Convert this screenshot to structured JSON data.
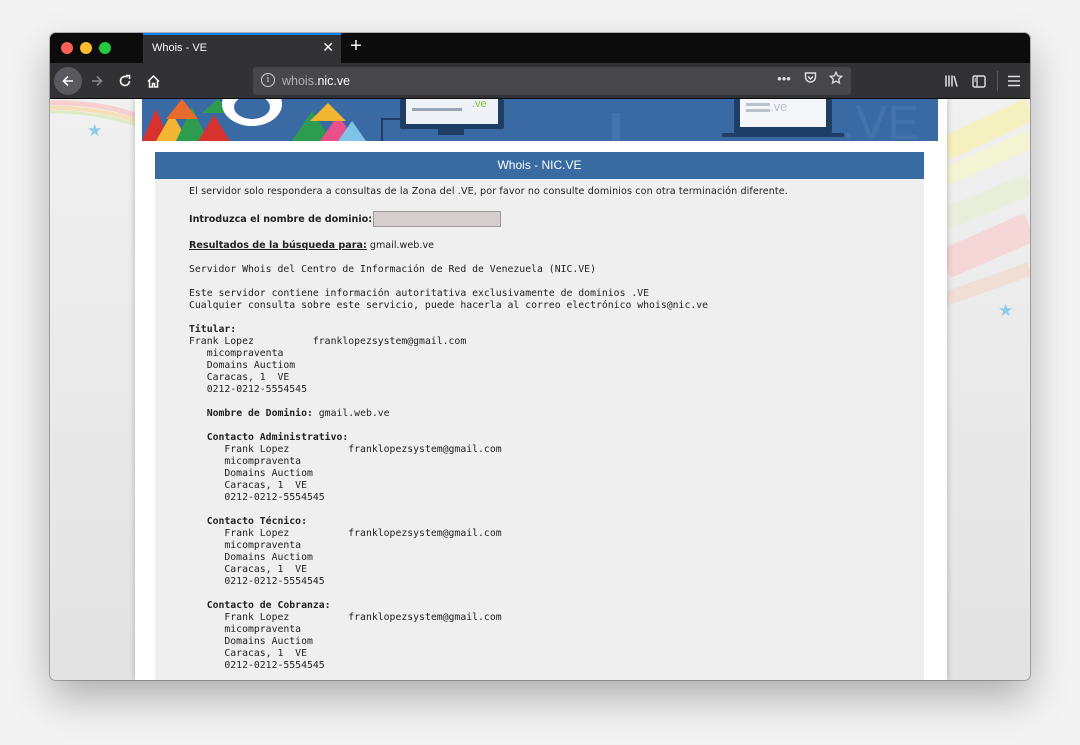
{
  "browser": {
    "tab_title": "Whois - VE",
    "tab_close": "✕",
    "new_tab": "+",
    "url_host_prefix": "whois.",
    "url_host_domain": "nic.ve"
  },
  "page": {
    "header_title": "Whois - NIC.VE",
    "notice": "El servidor solo respondera a consultas de la Zona del .VE, por favor no consulte dominios con otra terminación diferente.",
    "domain_label": "Introduzca el nombre de dominio:",
    "domain_input_value": "",
    "results_label": "Resultados de la búsqueda para:",
    "results_query": "gmail.web.ve",
    "whois_intro": [
      "Servidor Whois del Centro de Información de Red de Venezuela (NIC.VE)",
      "Este servidor contiene información autoritativa exclusivamente de dominios .VE",
      "Cualquier consulta sobre este servicio, puede hacerla al correo electrónico whois@nic.ve"
    ],
    "titular": {
      "label": "Titular:",
      "name": "Frank Lopez",
      "email": "franklopezsystem@gmail.com",
      "lines": [
        "micompraventa",
        "Domains Auctiom",
        "Caracas, 1  VE",
        "0212-0212-5554545"
      ]
    },
    "domain_name": {
      "label": "Nombre de Dominio:",
      "value": "gmail.web.ve"
    },
    "contacts": [
      {
        "label": "Contacto Administrativo:",
        "name": "Frank Lopez",
        "email": "franklopezsystem@gmail.com",
        "lines": [
          "micompraventa",
          "Domains Auctiom",
          "Caracas, 1  VE",
          "0212-0212-5554545"
        ]
      },
      {
        "label": "Contacto Técnico:",
        "name": "Frank Lopez",
        "email": "franklopezsystem@gmail.com",
        "lines": [
          "micompraventa",
          "Domains Auctiom",
          "Caracas, 1  VE",
          "0212-0212-5554545"
        ]
      },
      {
        "label": "Contacto de Cobranza:",
        "name": "Frank Lopez",
        "email": "franklopezsystem@gmail.com",
        "lines": [
          "micompraventa",
          "Domains Auctiom",
          "Caracas, 1  VE",
          "0212-0212-5554545"
        ]
      }
    ]
  },
  "colors": {
    "header_bar": "#386ba1",
    "banner": "#3a6aa3",
    "tab_accent": "#0a84ff"
  },
  "icons": [
    "back-arrow-icon",
    "forward-arrow-icon",
    "reload-icon",
    "home-icon",
    "info-icon",
    "more-icon",
    "pocket-icon",
    "bookmark-star-icon",
    "library-icon",
    "sidebar-icon",
    "hamburger-menu-icon"
  ]
}
